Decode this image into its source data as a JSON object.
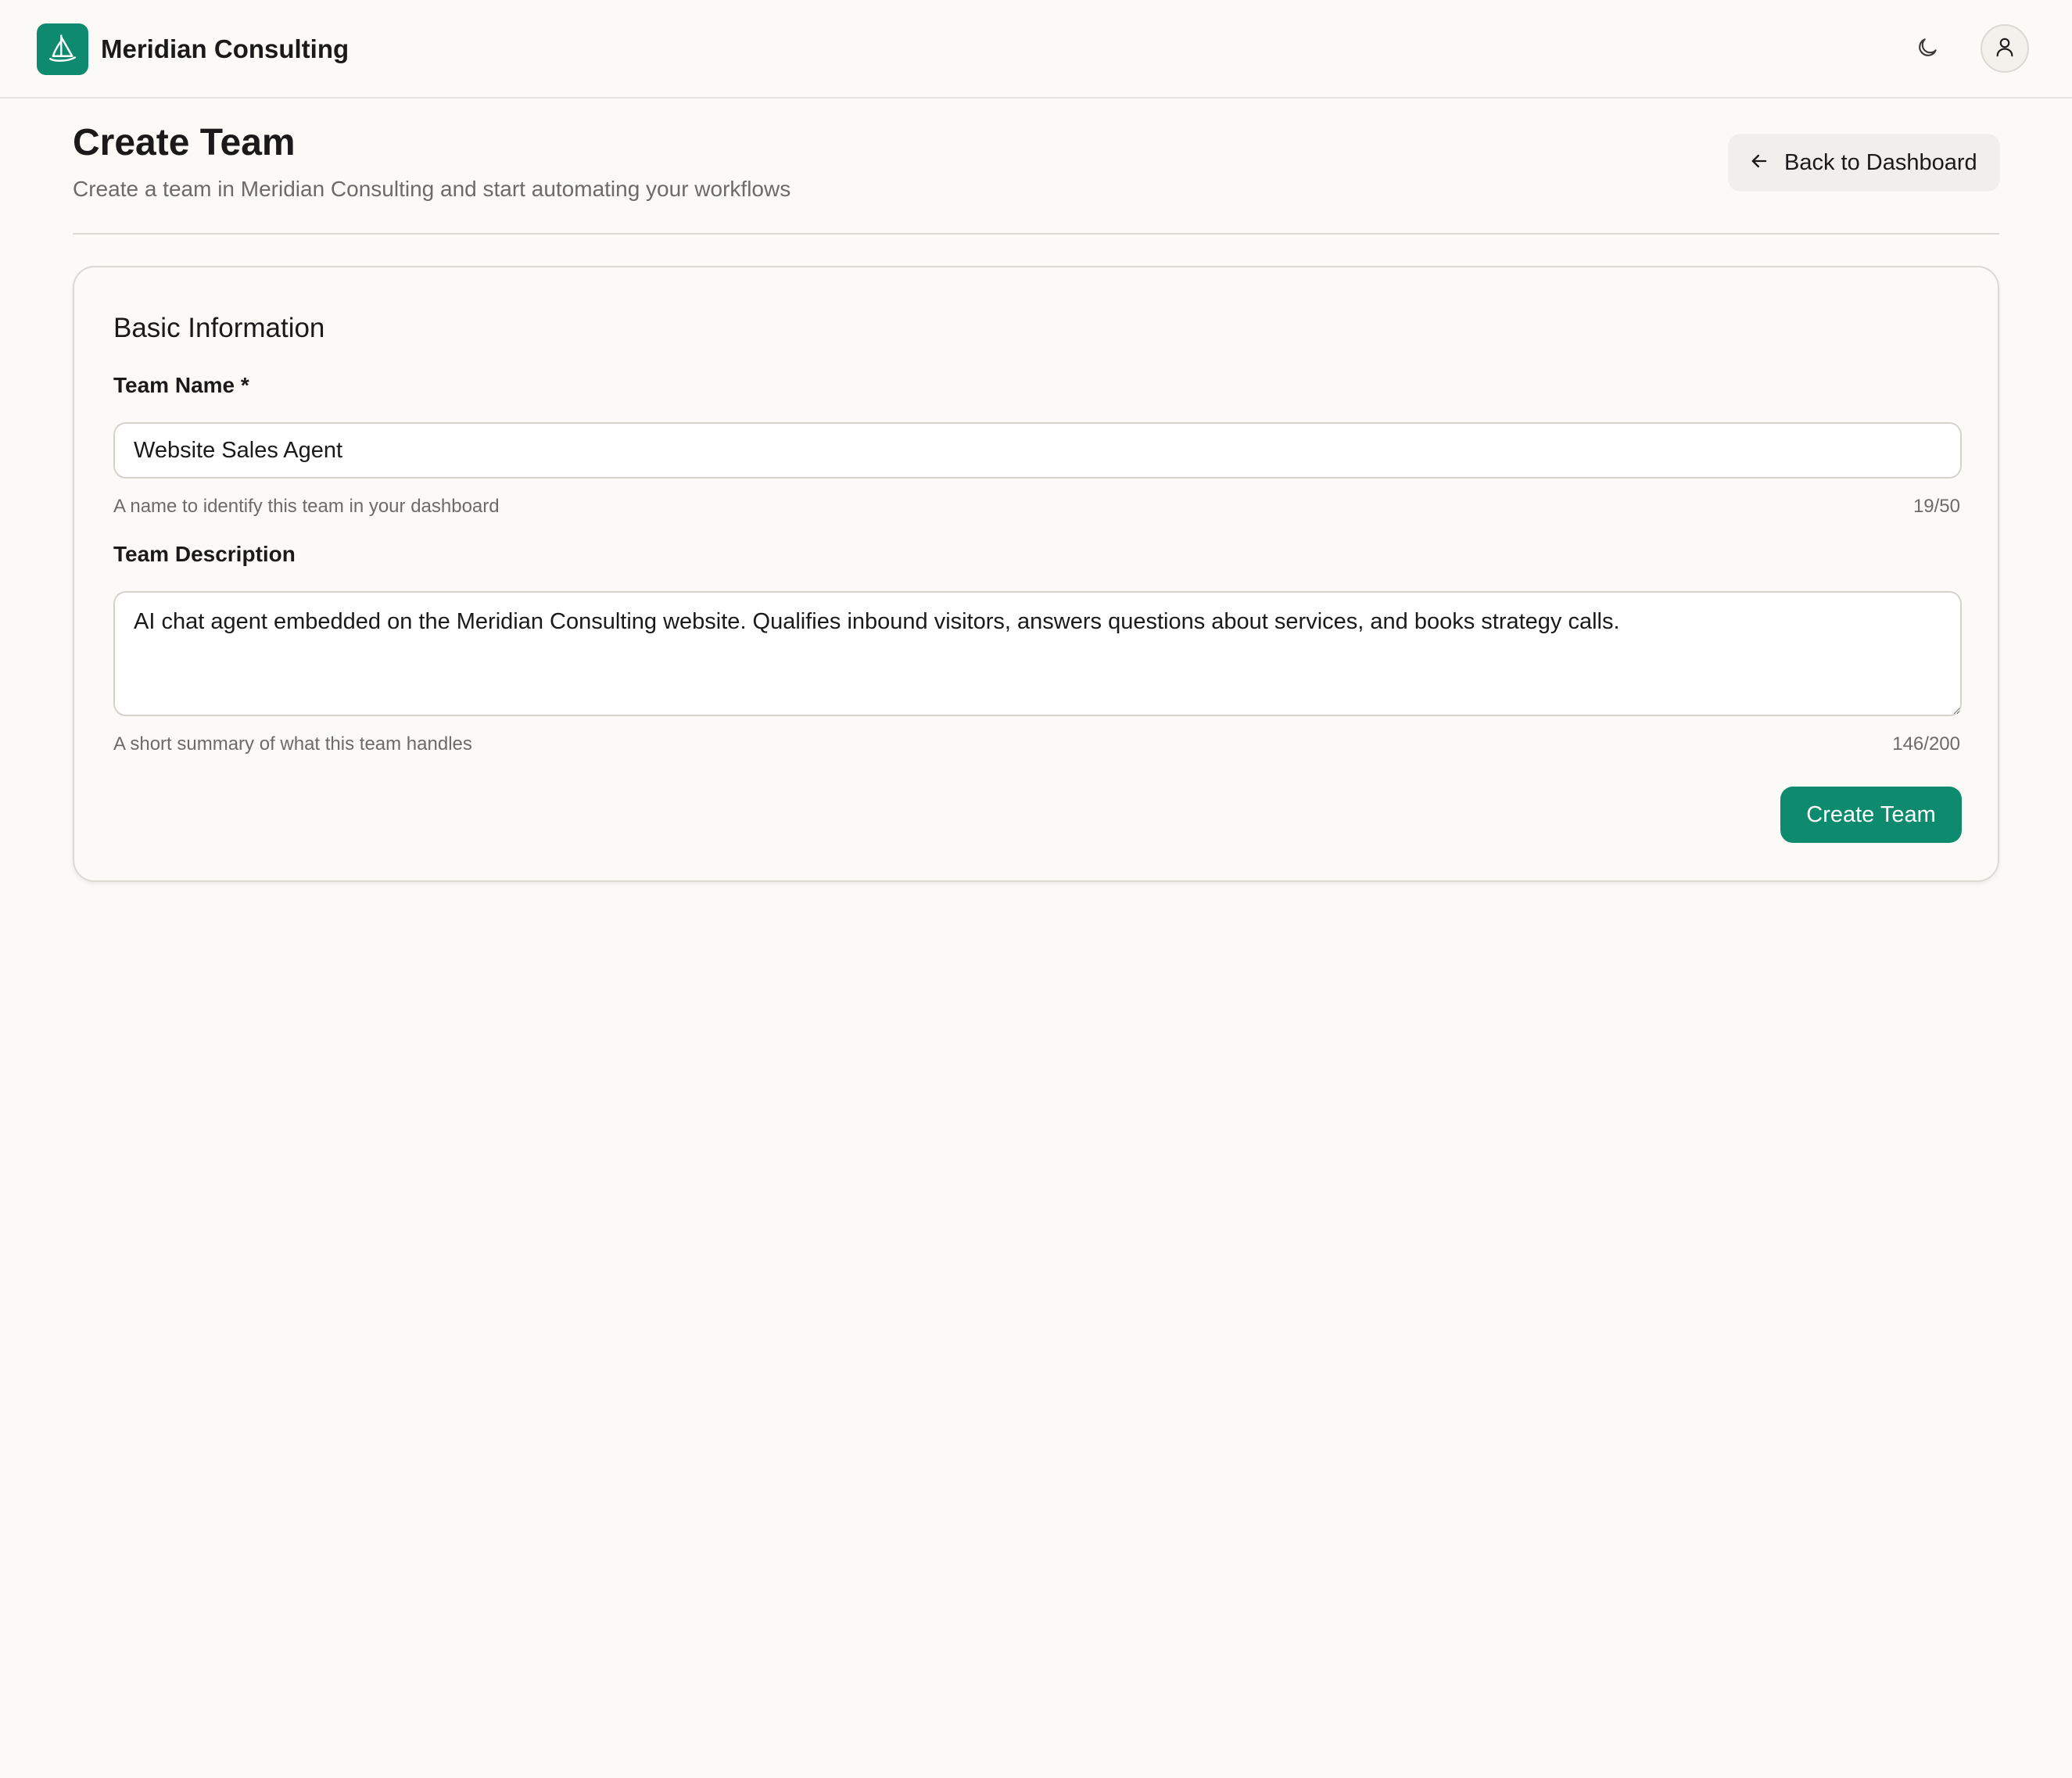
{
  "header": {
    "brand_name": "Meridian Consulting",
    "logo_icon": "sailboat-icon",
    "theme_toggle_icon": "moon-icon",
    "user_icon": "user-icon"
  },
  "page": {
    "title": "Create Team",
    "subtitle": "Create a team in Meridian Consulting and start automating your workflows",
    "back_button_label": "Back to Dashboard",
    "back_icon": "arrow-left-icon"
  },
  "form": {
    "section_title": "Basic Information",
    "team_name": {
      "label": "Team Name *",
      "value": "Website Sales Agent",
      "hint": "A name to identify this team in your dashboard",
      "counter": "19/50"
    },
    "team_description": {
      "label": "Team Description",
      "value": "AI chat agent embedded on the Meridian Consulting website. Qualifies inbound visitors, answers questions about services, and books strategy calls.",
      "hint": "A short summary of what this team handles",
      "counter": "146/200"
    },
    "submit_label": "Create Team"
  },
  "colors": {
    "accent": "#0e8a6e",
    "background": "#fcfaf6",
    "text": "#1a1a1a",
    "muted_text": "#6b6b6b"
  }
}
